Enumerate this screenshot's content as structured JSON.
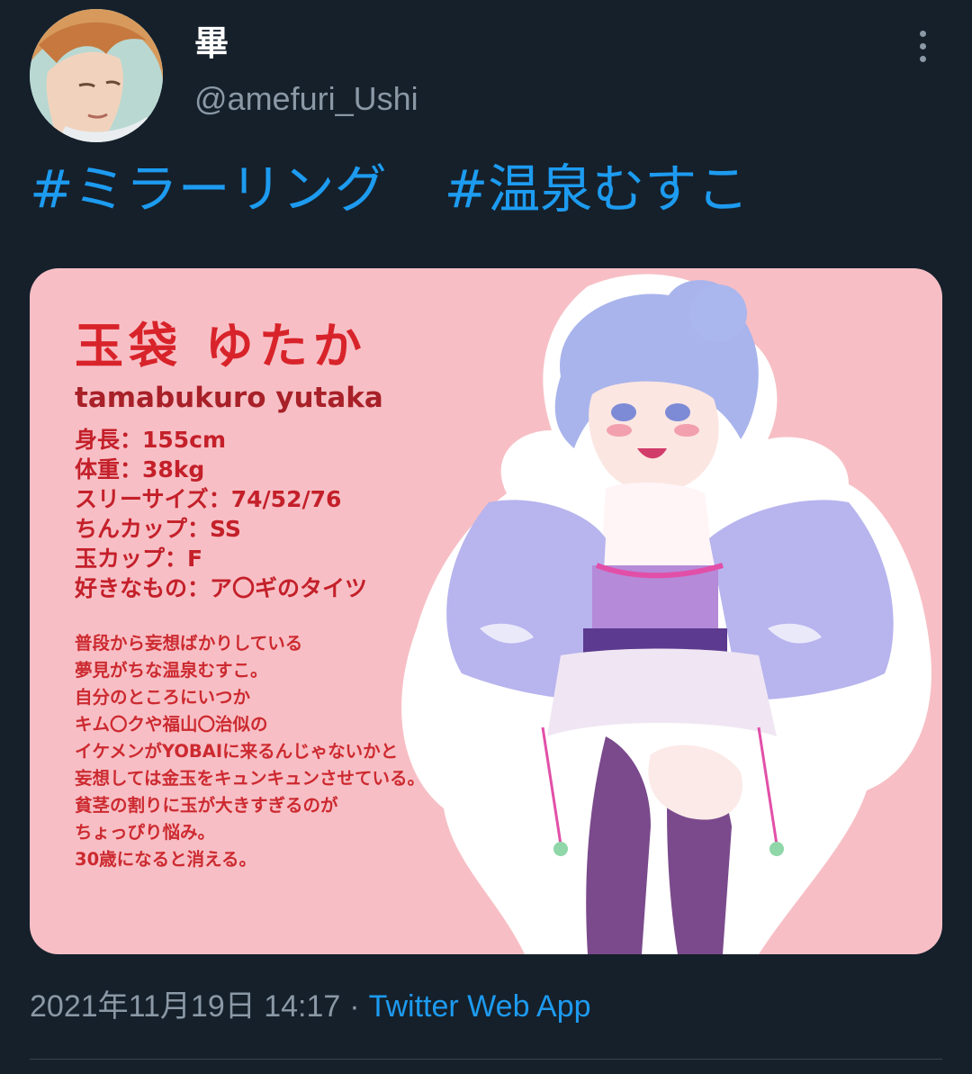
{
  "tweet": {
    "author": {
      "display_name": "畢",
      "handle": "@amefuri_Ushi",
      "avatar_icon": "avatar-portrait"
    },
    "more_icon": "more-vertical-icon",
    "hashtags": [
      "#ミラーリング",
      "#温泉むすこ"
    ],
    "media": {
      "title": "玉袋 ゆたか",
      "romaji": "tamabukuro yutaka",
      "stats": [
        "身長：155cm",
        "体重：38kg",
        "スリーサイズ：74/52/76",
        "ちんカップ：SS",
        "玉カップ：F",
        "好きなもの：ア〇ギのタイツ"
      ],
      "description": [
        "普段から妄想ばかりしている",
        "夢見がちな温泉むすこ。",
        "自分のところにいつか",
        "キム〇クや福山〇治似の",
        "イケメンがYOBAIに来るんじゃないかと",
        "妄想しては金玉をキュンキュンさせている。",
        "貧茎の割りに玉が大きすぎるのが",
        "ちょっぴり悩み。",
        "30歳になると消える。"
      ]
    },
    "timestamp": "2021年11月19日 14:17",
    "separator": "·",
    "source": "Twitter Web App"
  },
  "colors": {
    "background": "#15202b",
    "text_primary": "#ffffff",
    "text_secondary": "#8b98a5",
    "link": "#1d9bf0",
    "card_background": "#f7bfc5",
    "card_title": "#d8232a"
  }
}
